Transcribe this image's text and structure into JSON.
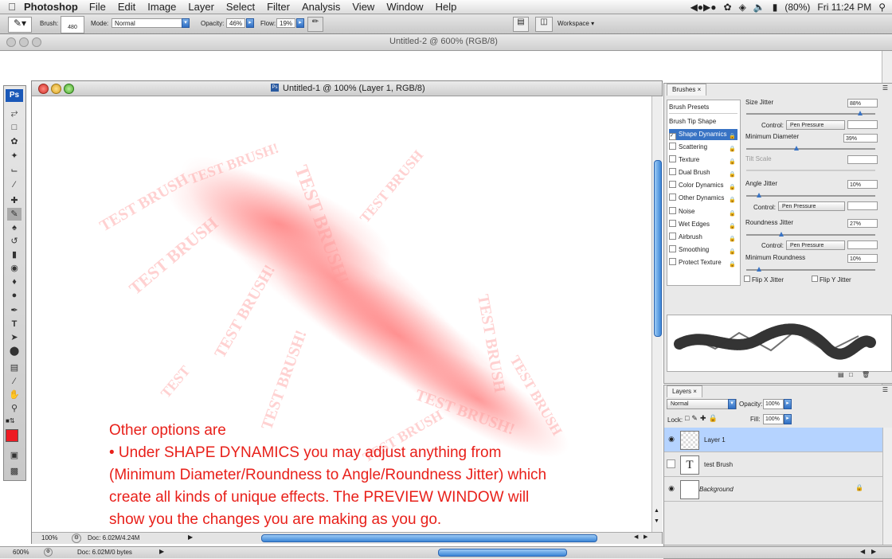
{
  "menubar": {
    "app_name": "Photoshop",
    "menus": [
      "File",
      "Edit",
      "Image",
      "Layer",
      "Select",
      "Filter",
      "Analysis",
      "View",
      "Window",
      "Help"
    ],
    "battery": "(80%)",
    "clock": "Fri 11:24 PM"
  },
  "options_bar": {
    "brush_label": "Brush:",
    "brush_size": "480",
    "mode_label": "Mode:",
    "mode_value": "Normal",
    "opacity_label": "Opacity:",
    "opacity_value": "46%",
    "flow_label": "Flow:",
    "flow_value": "19%",
    "workspace_label": "Workspace"
  },
  "back_document": {
    "title": "Untitled-2 @ 600% (RGB/8)",
    "zoom": "600%",
    "doc_info": "Doc: 6.02M/0 bytes"
  },
  "main_document": {
    "title": "Untitled-1 @ 100% (Layer 1, RGB/8)",
    "zoom": "100%",
    "doc_info": "Doc: 6.02M/4.24M",
    "overlay_lines": [
      "Other options are",
      "• Under SHAPE DYNAMICS you may adjust anything from",
      "(Minimum Diameter/Roundness to Angle/Roundness Jitter) which",
      "create all kinds of unique effects. The PREVIEW WINDOW will",
      "show you the changes you are making  as you go."
    ],
    "overlay_color": "#e8201a"
  },
  "brushes_panel": {
    "tab": "Brushes",
    "presets_label": "Brush Presets",
    "tip_shape_label": "Brush Tip Shape",
    "options": [
      {
        "label": "Shape Dynamics",
        "checked": true,
        "selected": true
      },
      {
        "label": "Scattering",
        "checked": false
      },
      {
        "label": "Texture",
        "checked": false
      },
      {
        "label": "Dual Brush",
        "checked": false
      },
      {
        "label": "Color Dynamics",
        "checked": false
      },
      {
        "label": "Other Dynamics",
        "checked": false
      },
      {
        "label": "Noise",
        "checked": false
      },
      {
        "label": "Wet Edges",
        "checked": false
      },
      {
        "label": "Airbrush",
        "checked": false
      },
      {
        "label": "Smoothing",
        "checked": false
      },
      {
        "label": "Protect Texture",
        "checked": false
      }
    ],
    "size_jitter_label": "Size Jitter",
    "size_jitter_value": "88%",
    "control_label": "Control:",
    "control_value": "Pen Pressure",
    "min_diameter_label": "Minimum Diameter",
    "min_diameter_value": "39%",
    "tilt_scale_label": "Tilt Scale",
    "angle_jitter_label": "Angle Jitter",
    "angle_jitter_value": "10%",
    "roundness_jitter_label": "Roundness Jitter",
    "roundness_jitter_value": "27%",
    "min_roundness_label": "Minimum Roundness",
    "min_roundness_value": "10%",
    "flip_x_label": "Flip X Jitter",
    "flip_y_label": "Flip Y Jitter",
    "slider_levels": {
      "size_jitter": 0.88,
      "min_diameter": 0.39,
      "angle_jitter": 0.1,
      "roundness_jitter": 0.27,
      "min_roundness": 0.1
    }
  },
  "layers_panel": {
    "tab": "Layers",
    "blend_mode": "Normal",
    "opacity_label": "Opacity:",
    "opacity_value": "100%",
    "lock_label": "Lock:",
    "fill_label": "Fill:",
    "fill_value": "100%",
    "layers": [
      {
        "name": "Layer 1",
        "visible": true,
        "selected": true
      },
      {
        "name": "test Brush",
        "visible": false,
        "thumb": "T"
      },
      {
        "name": "Background",
        "visible": true,
        "locked": true
      }
    ]
  },
  "colors": {
    "accent": "#3873c4",
    "selection": "#b5d3ff",
    "foreground_swatch": "#ee1c24"
  }
}
